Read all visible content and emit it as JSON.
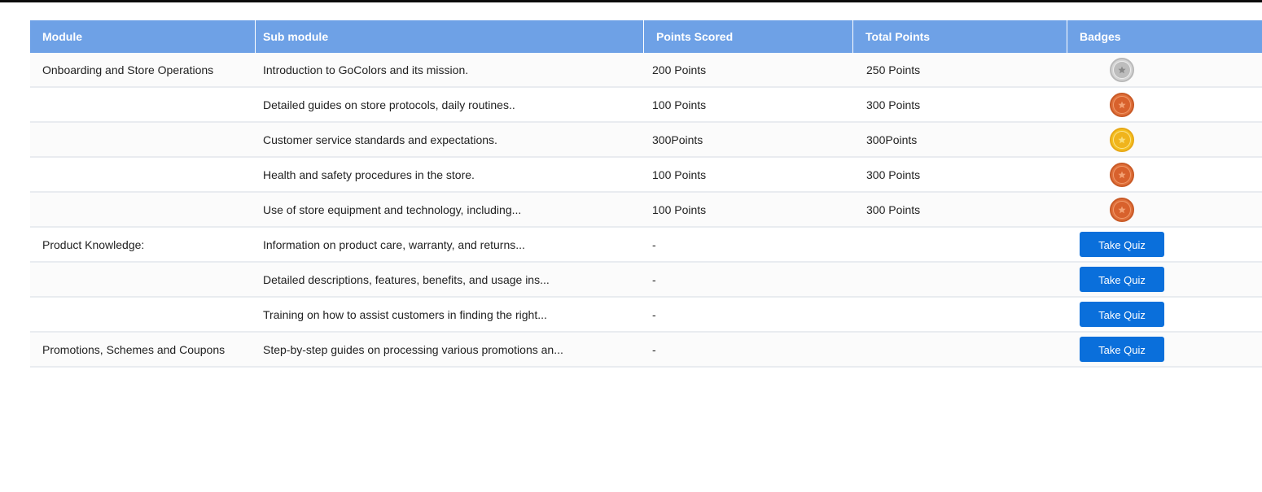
{
  "table": {
    "headers": {
      "module": "Module",
      "sub_module": "Sub module",
      "points_scored": "Points Scored",
      "total_points": "Total Points",
      "badges": "Badges"
    },
    "rows": [
      {
        "module": "Onboarding and Store Operations",
        "sub_module": "Introduction to GoColors and its mission.",
        "points_scored": "200 Points",
        "total_points": "250 Points",
        "badge": "silver",
        "badge_icon": "silver-medal-icon"
      },
      {
        "module": "",
        "sub_module": "Detailed guides on store protocols, daily routines..",
        "points_scored": "100 Points",
        "total_points": "300 Points",
        "badge": "bronze",
        "badge_icon": "bronze-medal-icon"
      },
      {
        "module": "",
        "sub_module": "Customer service standards and expectations.",
        "points_scored": "300Points",
        "total_points": "300Points",
        "badge": "gold",
        "badge_icon": "gold-medal-icon"
      },
      {
        "module": "",
        "sub_module": "Health and safety procedures in the store.",
        "points_scored": "100 Points",
        "total_points": "300 Points",
        "badge": "bronze",
        "badge_icon": "bronze-medal-icon"
      },
      {
        "module": "",
        "sub_module": "Use of store equipment and technology, including...",
        "points_scored": "100 Points",
        "total_points": "300 Points",
        "badge": "bronze",
        "badge_icon": "bronze-medal-icon"
      },
      {
        "module": "Product Knowledge:",
        "sub_module": "Information on product care, warranty, and returns...",
        "points_scored": "-",
        "total_points": "",
        "action_label": "Take Quiz"
      },
      {
        "module": "",
        "sub_module": "Detailed descriptions, features, benefits, and usage ins...",
        "points_scored": "-",
        "total_points": "",
        "action_label": "Take Quiz"
      },
      {
        "module": "",
        "sub_module": "Training on how to assist customers in finding the right...",
        "points_scored": "-",
        "total_points": "",
        "action_label": "Take Quiz"
      },
      {
        "module": "Promotions, Schemes and Coupons",
        "sub_module": "Step-by-step guides on processing various promotions an...",
        "points_scored": "-",
        "total_points": "",
        "action_label": "Take Quiz"
      }
    ]
  },
  "colors": {
    "header_bg": "#6ea1e6",
    "button_bg": "#0a6fdb",
    "silver": "#d4d4d4",
    "bronze": "#e0703b",
    "gold": "#f4c020"
  }
}
